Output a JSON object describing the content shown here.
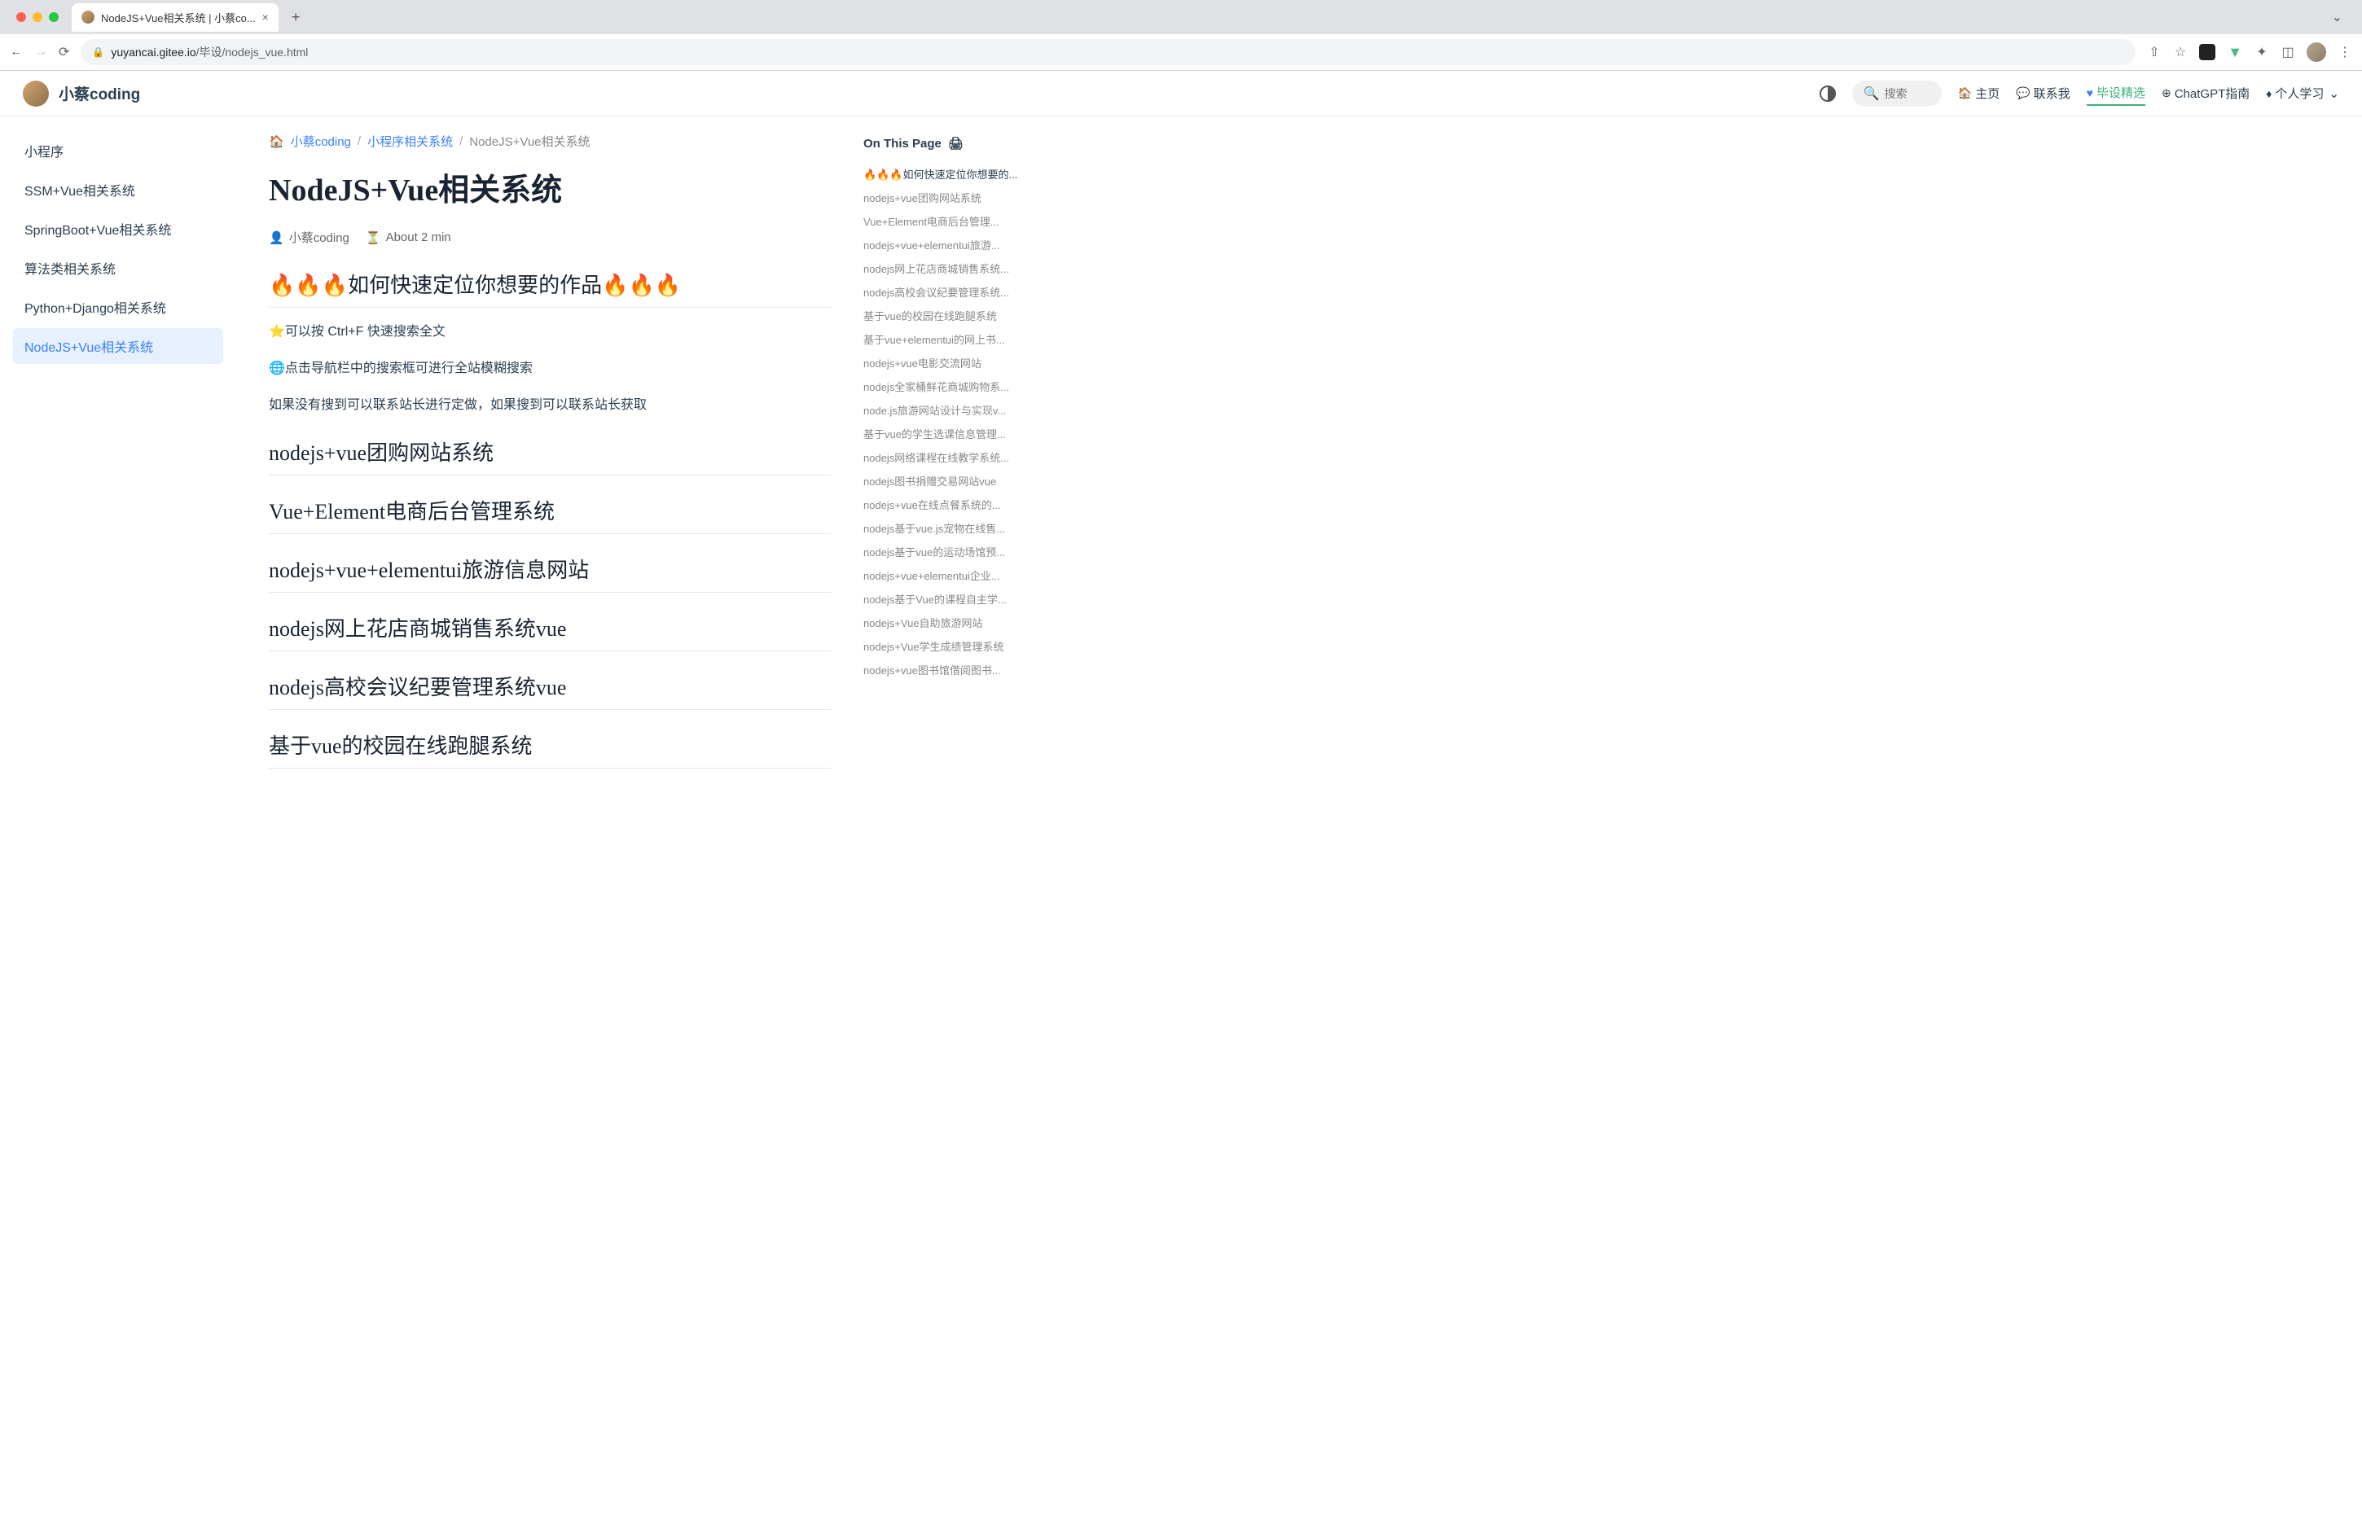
{
  "browser": {
    "tab_title": "NodeJS+Vue相关系统 | 小蔡co...",
    "url_domain": "yuyancai.gitee.io",
    "url_path": "/毕设/nodejs_vue.html"
  },
  "site": {
    "title": "小蔡coding",
    "search_placeholder": "搜索",
    "nav": [
      {
        "icon": "🏠",
        "label": "主页"
      },
      {
        "icon": "💬",
        "label": "联系我"
      },
      {
        "icon": "💙",
        "label": "毕设精选",
        "active": true
      },
      {
        "icon": "⊕",
        "label": "ChatGPT指南"
      },
      {
        "icon": "🔥",
        "label": "个人学习"
      }
    ]
  },
  "sidebar": {
    "items": [
      {
        "label": "小程序"
      },
      {
        "label": "SSM+Vue相关系统"
      },
      {
        "label": "SpringBoot+Vue相关系统"
      },
      {
        "label": "算法类相关系统"
      },
      {
        "label": "Python+Django相关系统"
      },
      {
        "label": "NodeJS+Vue相关系统",
        "active": true
      }
    ]
  },
  "breadcrumb": {
    "home": "小蔡coding",
    "mid": "小程序相关系统",
    "current": "NodeJS+Vue相关系统"
  },
  "page": {
    "title": "NodeJS+Vue相关系统",
    "author": "小蔡coding",
    "read_time": "About 2 min",
    "h1": "🔥🔥🔥如何快速定位你想要的作品🔥🔥🔥",
    "p1": "⭐可以按 Ctrl+F 快速搜索全文",
    "p2": "🌐点击导航栏中的搜索框可进行全站模糊搜索",
    "p3": "如果没有搜到可以联系站长进行定做，如果搜到可以联系站长获取",
    "sections": [
      "nodejs+vue团购网站系统",
      "Vue+Element电商后台管理系统",
      "nodejs+vue+elementui旅游信息网站",
      "nodejs网上花店商城销售系统vue",
      "nodejs高校会议纪要管理系统vue",
      "基于vue的校园在线跑腿系统"
    ]
  },
  "toc": {
    "title": "On This Page",
    "items": [
      "🔥🔥🔥如何快速定位你想要的...",
      "nodejs+vue团购网站系统",
      "Vue+Element电商后台管理...",
      "nodejs+vue+elementui旅游...",
      "nodejs网上花店商城销售系统...",
      "nodejs高校会议纪要管理系统...",
      "基于vue的校园在线跑腿系统",
      "基于vue+elementui的网上书...",
      "nodejs+vue电影交流网站",
      "nodejs全家桶鲜花商城购物系...",
      "node.js旅游网站设计与实现v...",
      "基于vue的学生选课信息管理...",
      "nodejs网络课程在线教学系统...",
      "nodejs图书捐赠交易网站vue",
      "nodejs+vue在线点餐系统的...",
      "nodejs基于vue.js宠物在线售...",
      "nodejs基于vue的运动场馆预...",
      "nodejs+vue+elementui企业...",
      "nodejs基于Vue的课程自主学...",
      "nodejs+Vue自助旅游网站",
      "nodejs+Vue学生成绩管理系统",
      "nodejs+vue图书馆借阅图书..."
    ]
  }
}
